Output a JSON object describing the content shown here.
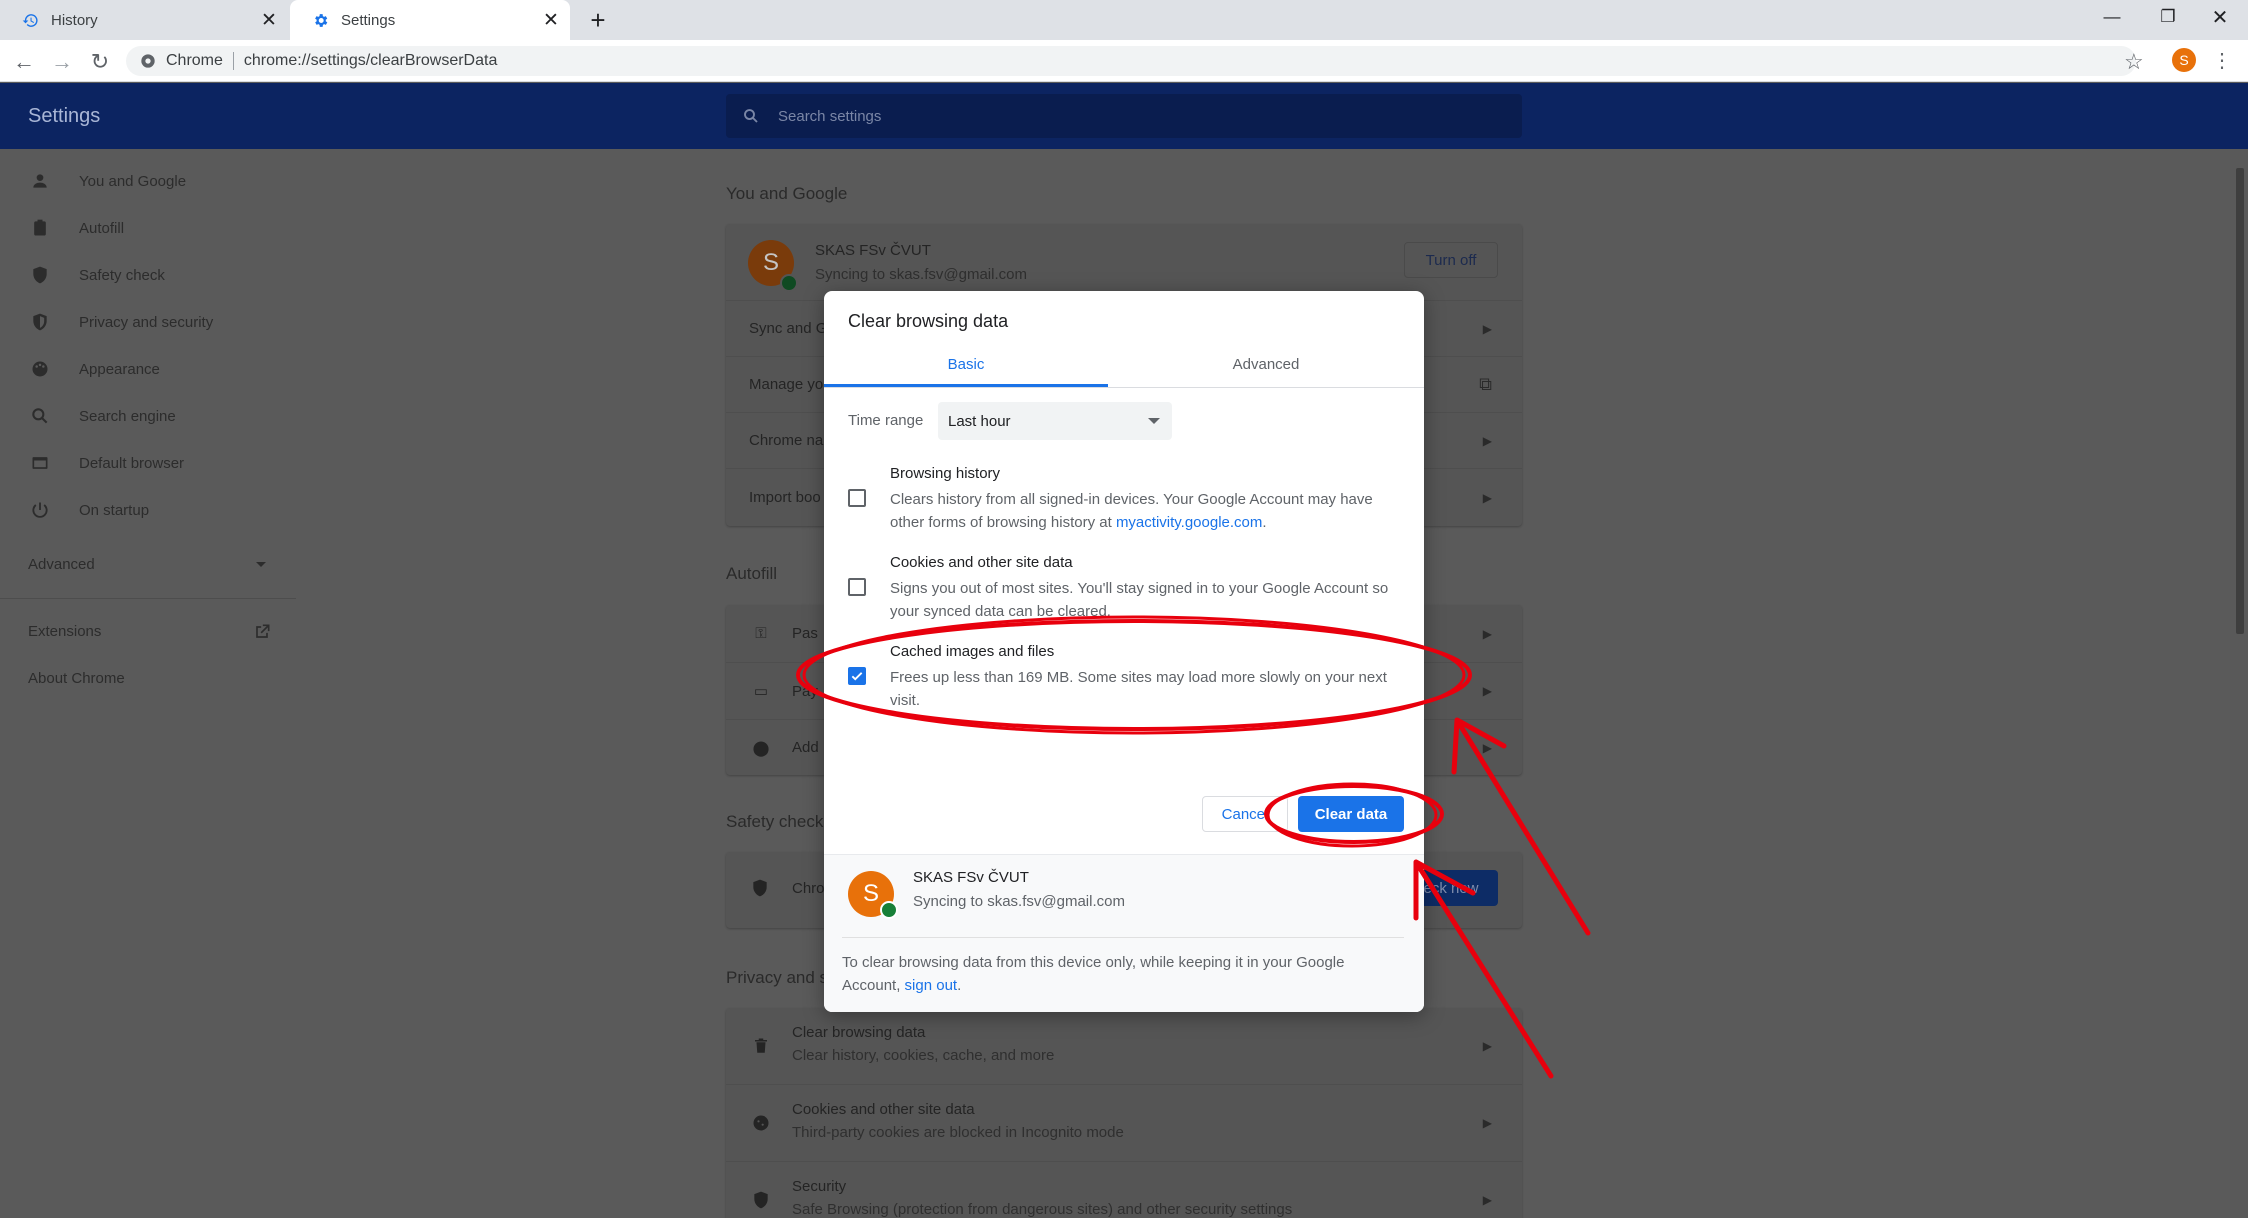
{
  "browser": {
    "tabs": [
      {
        "label": "History",
        "icon": "history-icon"
      },
      {
        "label": "Settings",
        "icon": "gear-icon"
      }
    ],
    "omnibox_chip": "Chrome",
    "url": "chrome://settings/clearBrowserData",
    "profile_initial": "S"
  },
  "settings": {
    "header_title": "Settings",
    "search_placeholder": "Search settings",
    "sidebar": [
      {
        "label": "You and Google",
        "icon": "person-icon"
      },
      {
        "label": "Autofill",
        "icon": "clipboard-icon"
      },
      {
        "label": "Safety check",
        "icon": "shield-check-icon"
      },
      {
        "label": "Privacy and security",
        "icon": "shield-icon"
      },
      {
        "label": "Appearance",
        "icon": "palette-icon"
      },
      {
        "label": "Search engine",
        "icon": "search-icon"
      },
      {
        "label": "Default browser",
        "icon": "browser-icon"
      },
      {
        "label": "On startup",
        "icon": "power-icon"
      }
    ],
    "advanced_label": "Advanced",
    "extensions_label": "Extensions",
    "about_label": "About Chrome",
    "sections": {
      "you_and_google": {
        "title": "You and Google",
        "account_name": "SKAS FSv ČVUT",
        "account_sync": "Syncing to skas.fsv@gmail.com",
        "turn_off": "Turn off",
        "rows": [
          "Sync and G",
          "Manage yo",
          "Chrome na",
          "Import boo"
        ]
      },
      "autofill": {
        "title": "Autofill",
        "rows": [
          "Pas",
          "Pay",
          "Add"
        ]
      },
      "safety_check": {
        "title": "Safety check",
        "row": "Chro",
        "check_now": "eck now"
      },
      "privacy": {
        "title": "Privacy and s",
        "rows": [
          {
            "title": "Clear browsing data",
            "sub": "Clear history, cookies, cache, and more"
          },
          {
            "title": "Cookies and other site data",
            "sub": "Third-party cookies are blocked in Incognito mode"
          },
          {
            "title": "Security",
            "sub": "Safe Browsing (protection from dangerous sites) and other security settings"
          }
        ]
      }
    }
  },
  "dialog": {
    "title": "Clear browsing data",
    "tabs": [
      "Basic",
      "Advanced"
    ],
    "time_range_label": "Time range",
    "time_range_value": "Last hour",
    "options": [
      {
        "title": "Browsing history",
        "desc": "Clears history from all signed-in devices. Your Google Account may have other forms of browsing history at ",
        "link": "myactivity.google.com",
        "desc_end": ".",
        "checked": false
      },
      {
        "title": "Cookies and other site data",
        "desc": "Signs you out of most sites. You'll stay signed in to your Google Account so your synced data can be cleared.",
        "checked": false
      },
      {
        "title": "Cached images and files",
        "desc": "Frees up less than 169 MB. Some sites may load more slowly on your next visit.",
        "checked": true
      }
    ],
    "cancel_label": "Cancel",
    "clear_label": "Clear data",
    "footer": {
      "initial": "S",
      "name": "SKAS FSv ČVUT",
      "sync": "Syncing to skas.fsv@gmail.com",
      "note": "To clear browsing data from this device only, while keeping it in your Google Account, ",
      "note_link": "sign out",
      "note_end": "."
    }
  },
  "colors": {
    "accent": "#1a73e8",
    "annotation": "#e8000d",
    "header_dimmed": "#0c2461"
  }
}
